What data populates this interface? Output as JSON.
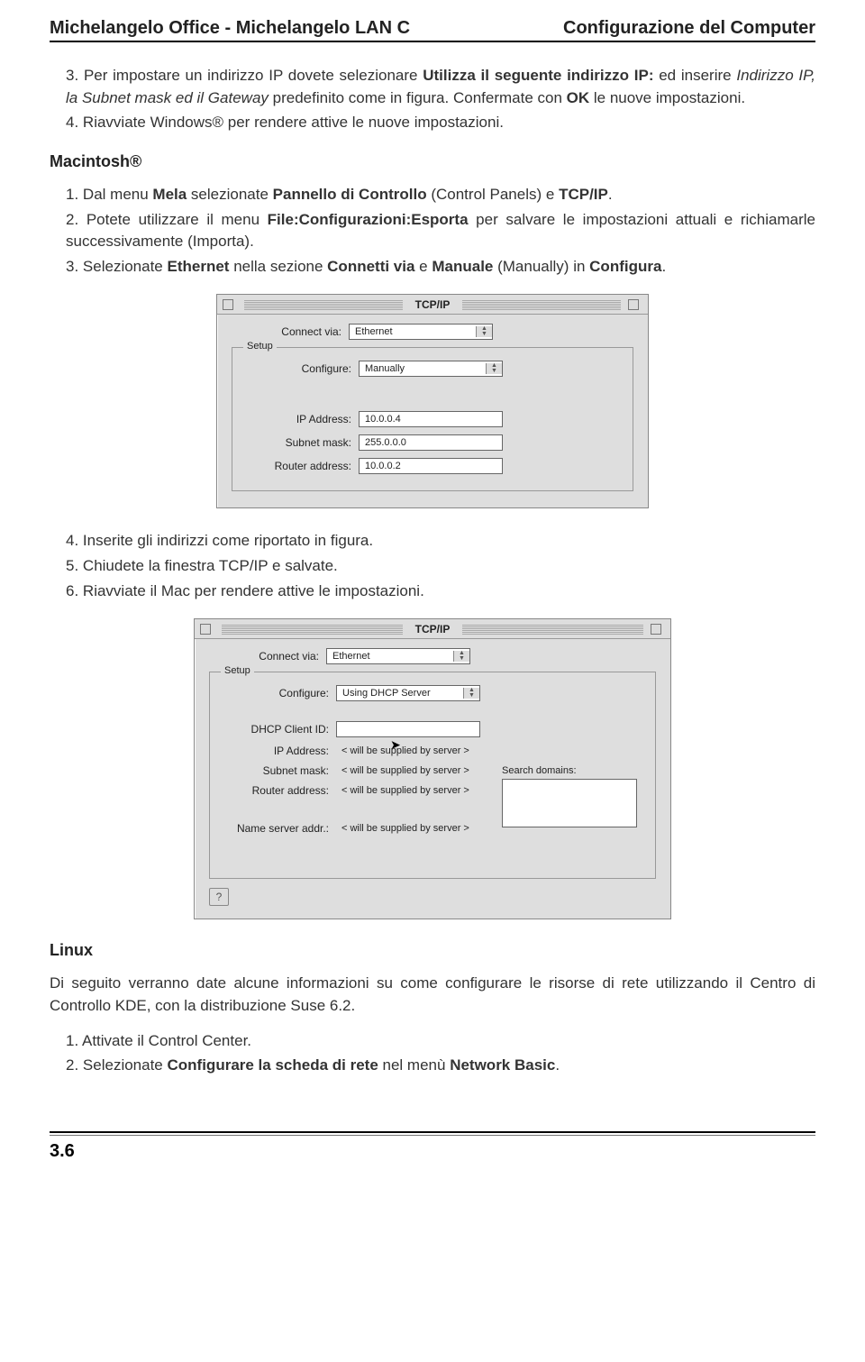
{
  "header": {
    "left": "Michelangelo Office - Michelangelo LAN C",
    "right": "Configurazione del Computer"
  },
  "intro_list": {
    "item3": {
      "num": "3.",
      "pre": "Per impostare un indirizzo IP dovete selezionare ",
      "bold1": "Utilizza il seguente indirizzo IP:",
      "mid1": " ed inserire ",
      "italic1": "Indirizzo IP, la Subnet mask ed il Gateway",
      "mid2": " predefinito come in figura. Confermate con ",
      "bold2": "OK",
      "post": " le nuove impostazioni."
    },
    "item4": {
      "num": "4.",
      "text": "Riavviate Windows® per rendere attive le nuove impostazioni."
    }
  },
  "mac_section_title": "Macintosh®",
  "mac_list": {
    "item1": {
      "num": "1.",
      "pre": "Dal menu ",
      "bold1": "Mela",
      "mid1": " selezionate ",
      "bold2": "Pannello di Controllo",
      "mid2": " (Control Panels) e ",
      "bold3": "TCP/IP",
      "post": "."
    },
    "item2": {
      "num": "2.",
      "pre": "Potete utilizzare il menu ",
      "bold1": "File:Configurazioni:Esporta",
      "post": " per salvare le impostazioni attuali e richiamarle successivamente (Importa)."
    },
    "item3": {
      "num": "3.",
      "pre": "Selezionate ",
      "bold1": "Ethernet",
      "mid1": " nella sezione ",
      "bold2": "Connetti via",
      "mid2": " e ",
      "bold3": "Manuale",
      "mid3": " (Manually) in ",
      "bold4": "Configura",
      "post": "."
    }
  },
  "mac_window1": {
    "title": "TCP/IP",
    "connect_via_label": "Connect via:",
    "connect_via_value": "Ethernet",
    "setup_label": "Setup",
    "configure_label": "Configure:",
    "configure_value": "Manually",
    "ip_label": "IP Address:",
    "ip_value": "10.0.0.4",
    "subnet_label": "Subnet mask:",
    "subnet_value": "255.0.0.0",
    "router_label": "Router address:",
    "router_value": "10.0.0.2"
  },
  "mac_list2": {
    "item4": {
      "num": "4.",
      "text": "Inserite gli indirizzi come riportato in figura."
    },
    "item5": {
      "num": "5.",
      "text": "Chiudete la finestra TCP/IP e salvate."
    },
    "item6": {
      "num": "6.",
      "text": "Riavviate il Mac per rendere attive le impostazioni."
    }
  },
  "mac_window2": {
    "title": "TCP/IP",
    "connect_via_label": "Connect via:",
    "connect_via_value": "Ethernet",
    "setup_label": "Setup",
    "configure_label": "Configure:",
    "configure_value": "Using DHCP Server",
    "dhcp_label": "DHCP Client ID:",
    "ip_label": "IP Address:",
    "ip_value": "< will be supplied by server >",
    "subnet_label": "Subnet mask:",
    "subnet_value": "< will be supplied by server >",
    "router_label": "Router address:",
    "router_value": "< will be supplied by server >",
    "ns_label": "Name server addr.:",
    "ns_value": "< will be supplied by server >",
    "search_label": "Search domains:",
    "help_glyph": "?"
  },
  "linux_section_title": "Linux",
  "linux_intro": "Di seguito verranno date alcune informazioni su come configurare le risorse di rete utilizzando il Centro di Controllo KDE, con la distribuzione Suse 6.2.",
  "linux_list": {
    "item1": {
      "num": "1.",
      "text": "Attivate il Control Center."
    },
    "item2": {
      "num": "2.",
      "pre": "Selezionate ",
      "bold1": "Configurare la scheda di rete",
      "mid1": " nel menù ",
      "bold2": "Network Basic",
      "post": "."
    }
  },
  "footer": {
    "page_num": "3.6"
  }
}
